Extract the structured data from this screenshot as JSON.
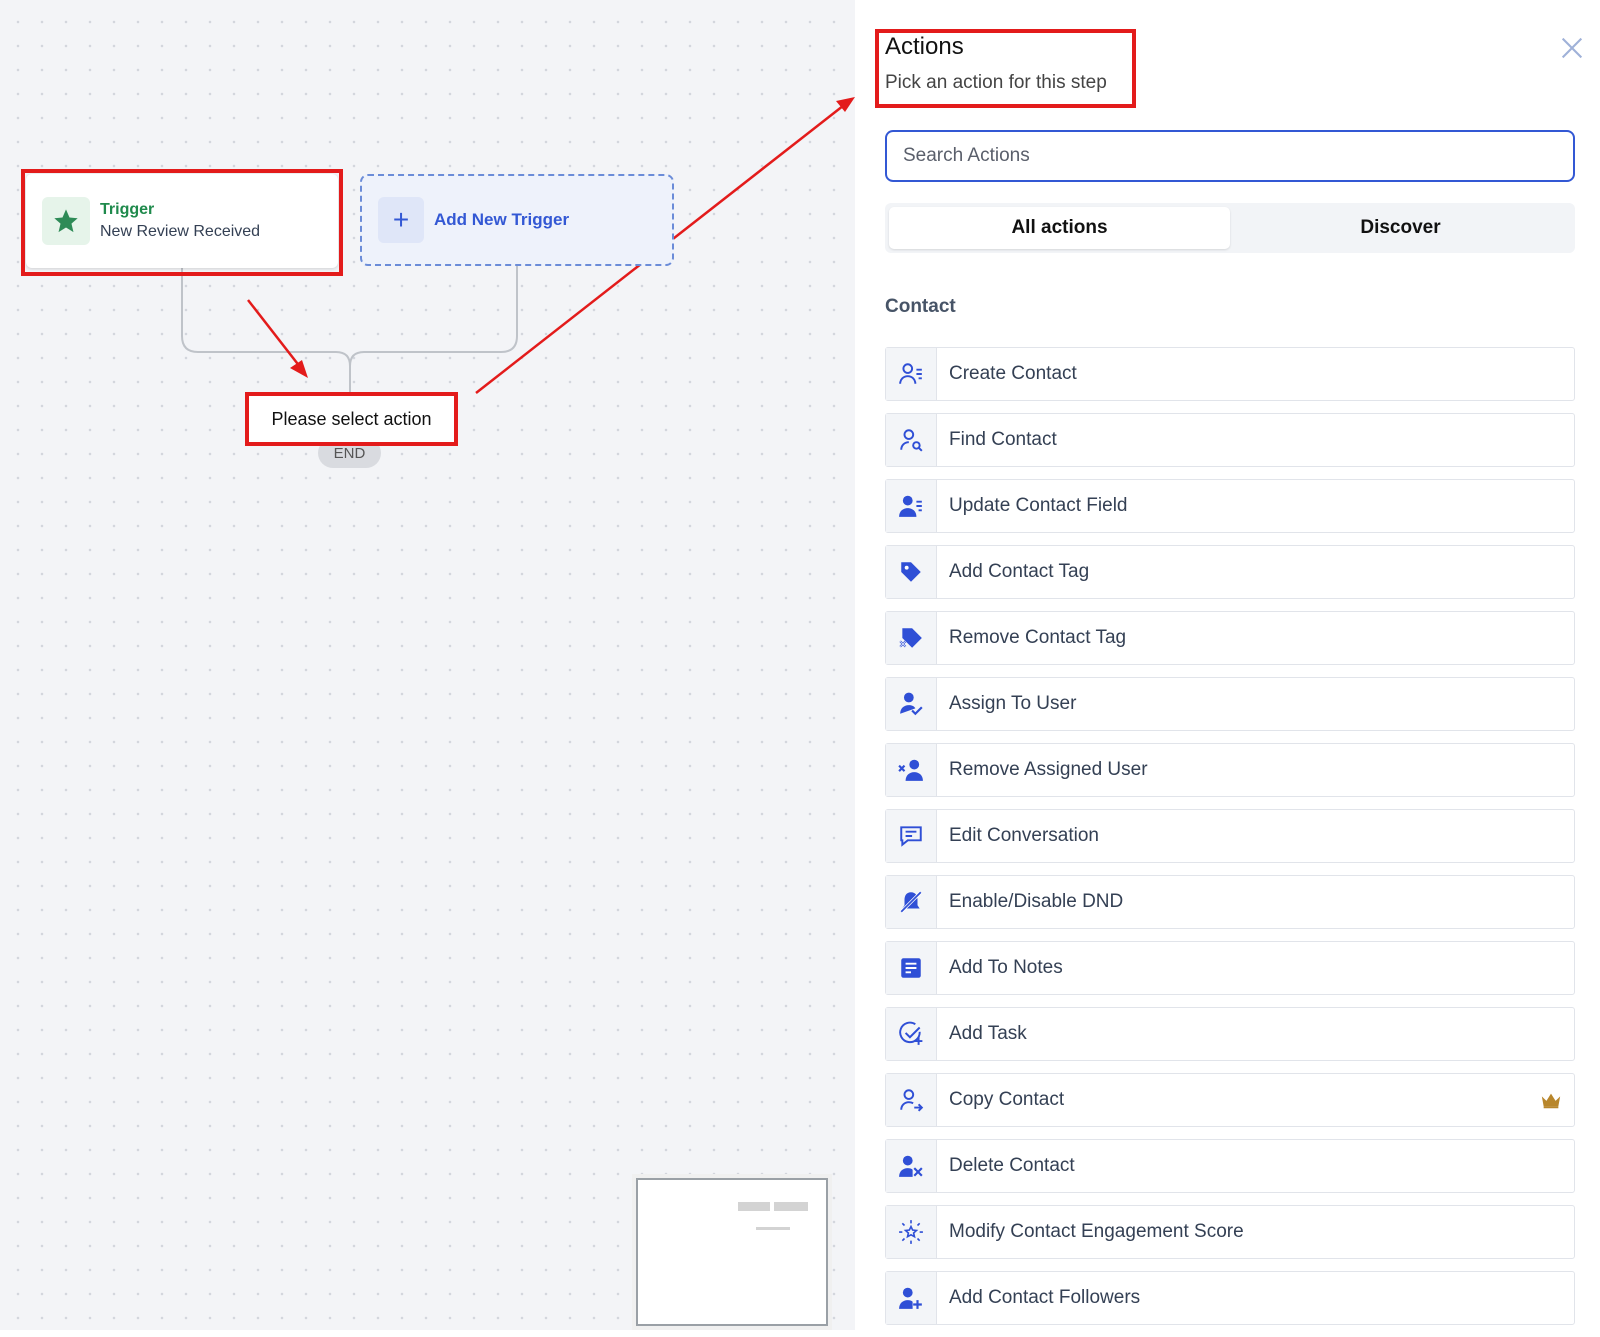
{
  "canvas": {
    "trigger": {
      "label": "Trigger",
      "value": "New Review Received"
    },
    "add_trigger": {
      "plus": "+",
      "label": "Add New Trigger"
    },
    "placeholder_action": "Please select action",
    "end_label": "END"
  },
  "panel": {
    "title": "Actions",
    "subtitle": "Pick an action for this step",
    "search": {
      "placeholder": "Search Actions"
    },
    "tabs": [
      {
        "label": "All actions",
        "active": true
      },
      {
        "label": "Discover",
        "active": false
      }
    ],
    "section_title": "Contact",
    "items": [
      {
        "label": "Create Contact",
        "icon": "user-list-icon"
      },
      {
        "label": "Find Contact",
        "icon": "user-search-icon"
      },
      {
        "label": "Update Contact Field",
        "icon": "user-edit-icon"
      },
      {
        "label": "Add Contact Tag",
        "icon": "tag-icon"
      },
      {
        "label": "Remove Contact Tag",
        "icon": "tag-remove-icon"
      },
      {
        "label": "Assign To User",
        "icon": "user-check-icon"
      },
      {
        "label": "Remove Assigned User",
        "icon": "user-remove-icon"
      },
      {
        "label": "Edit Conversation",
        "icon": "chat-icon"
      },
      {
        "label": "Enable/Disable DND",
        "icon": "bell-off-icon"
      },
      {
        "label": "Add To Notes",
        "icon": "note-icon"
      },
      {
        "label": "Add Task",
        "icon": "task-add-icon"
      },
      {
        "label": "Copy Contact",
        "icon": "user-arrow-icon",
        "premium": true
      },
      {
        "label": "Delete Contact",
        "icon": "user-delete-icon"
      },
      {
        "label": "Modify Contact Engagement Score",
        "icon": "sparkle-star-icon"
      },
      {
        "label": "Add Contact Followers",
        "icon": "user-plus-icon"
      }
    ]
  },
  "colors": {
    "accent": "#3358d4",
    "icon_blue": "#2f4fd6",
    "annotation_red": "#e31b1b",
    "trigger_green": "#1f8a4c",
    "crown_gold": "#b8862b"
  }
}
